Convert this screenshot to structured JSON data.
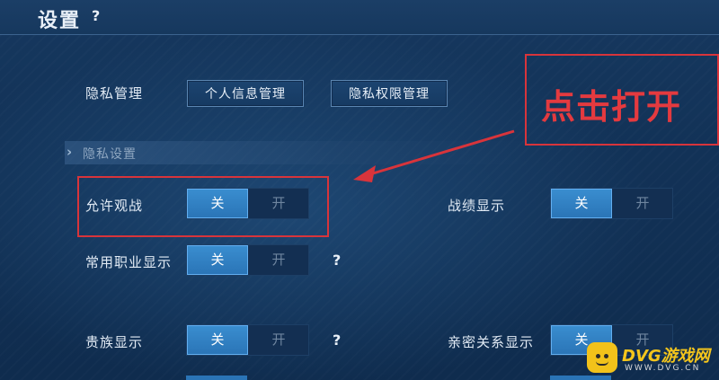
{
  "header": {
    "title": "设置",
    "help": "?"
  },
  "privacy_management": {
    "label": "隐私管理",
    "buttons": [
      {
        "label": "个人信息管理"
      },
      {
        "label": "隐私权限管理"
      }
    ]
  },
  "section": {
    "title": "隐私设置"
  },
  "settings": [
    {
      "label": "允许观战",
      "off": "关",
      "on": "开",
      "selected": "关",
      "help": ""
    },
    {
      "label": "战绩显示",
      "off": "关",
      "on": "开",
      "selected": "关",
      "help": ""
    },
    {
      "label": "常用职业显示",
      "off": "关",
      "on": "开",
      "selected": "关",
      "help": "?"
    },
    {
      "label": "贵族显示",
      "off": "关",
      "on": "开",
      "selected": "关",
      "help": "?"
    },
    {
      "label": "亲密关系显示",
      "off": "关",
      "on": "开",
      "selected": "关",
      "help": ""
    }
  ],
  "annotation": {
    "text": "点击打开",
    "color": "#d8343b"
  },
  "watermark": {
    "title": "DVG游戏网",
    "subtitle": "WWW.DVG.CN"
  },
  "colors": {
    "background": "#123257",
    "toggle_active": "#2a74b6",
    "toggle_inactive_text": "#6f86a0"
  }
}
